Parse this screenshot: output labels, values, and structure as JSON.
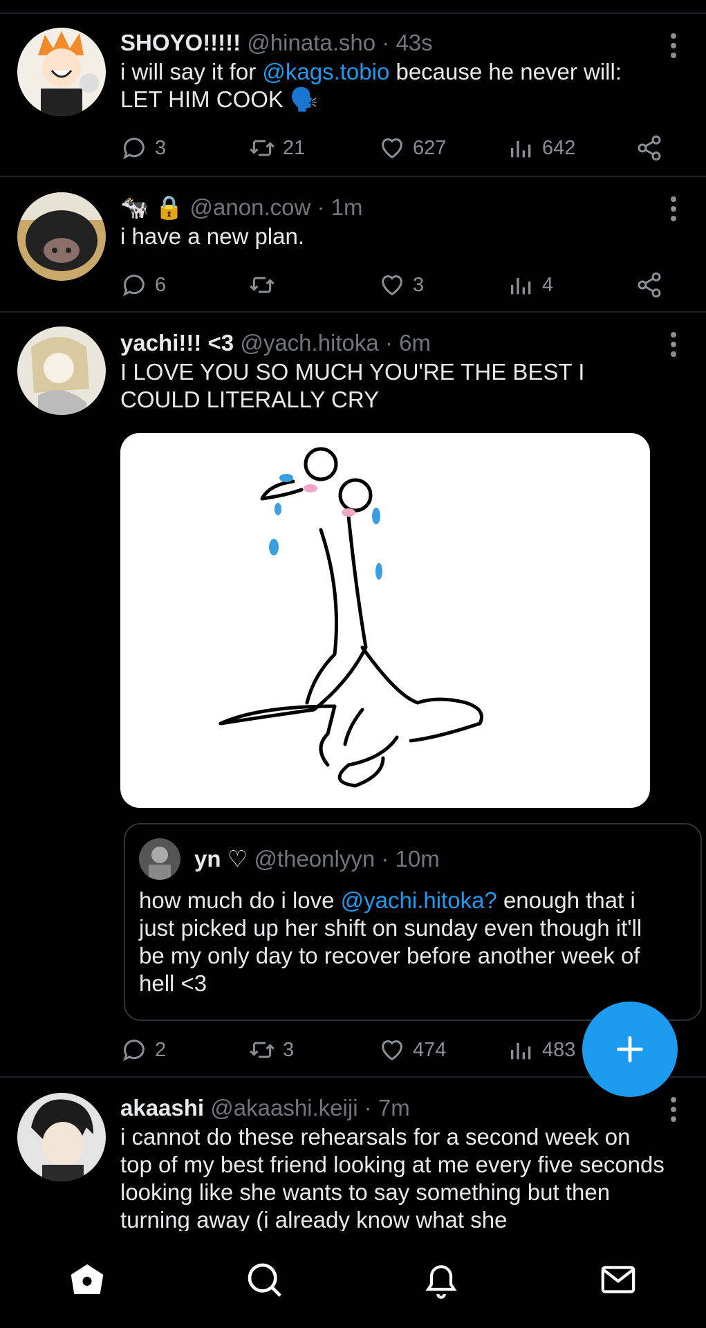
{
  "posts": [
    {
      "name": "SHOYO!!!!!",
      "handle": "@hinata.sho",
      "sep": "·",
      "time": "43s",
      "text_before": "i will say it for ",
      "mention": "@kags.tobio",
      "text_after": " because he never will: LET HIM COOK 🗣️",
      "replies": "3",
      "reposts": "21",
      "likes": "627",
      "views": "642"
    },
    {
      "name": "🐄 🔒",
      "handle": "@anon.cow",
      "sep": "·",
      "time": "1m",
      "text": "i have a new plan.",
      "replies": "6",
      "reposts": "",
      "likes": "3",
      "views": "4"
    },
    {
      "name": "yachi!!! <3",
      "handle": "@yach.hitoka",
      "sep": "·",
      "time": "6m",
      "text": "I LOVE YOU SO MUCH YOU'RE THE BEST I COULD LITERALLY CRY",
      "quote": {
        "name": "yn ♡",
        "handle": "@theonlyyn",
        "sep": "·",
        "time": "10m",
        "text_before": "how much do i love ",
        "mention": "@yachi.hitoka?",
        "text_after": " enough that i just picked up her shift on sunday even though it'll be my only day to recover before another week of hell <3"
      },
      "replies": "2",
      "reposts": "3",
      "likes": "474",
      "views": "483"
    },
    {
      "name": "akaashi",
      "handle": "@akaashi.keiji",
      "sep": "·",
      "time": "7m",
      "text": "i cannot do these rehearsals for a second week on top of my best friend looking at me every five seconds looking like she wants to say something but then turning away (i already know what she"
    }
  ],
  "colors": {
    "accent": "#1d9bf0",
    "muted": "#71767b",
    "background": "#000000"
  },
  "icons": [
    "reply-icon",
    "repost-icon",
    "like-icon",
    "views-icon",
    "share-icon",
    "more-icon",
    "compose-icon",
    "home-icon",
    "search-icon",
    "bell-icon",
    "mail-icon"
  ]
}
